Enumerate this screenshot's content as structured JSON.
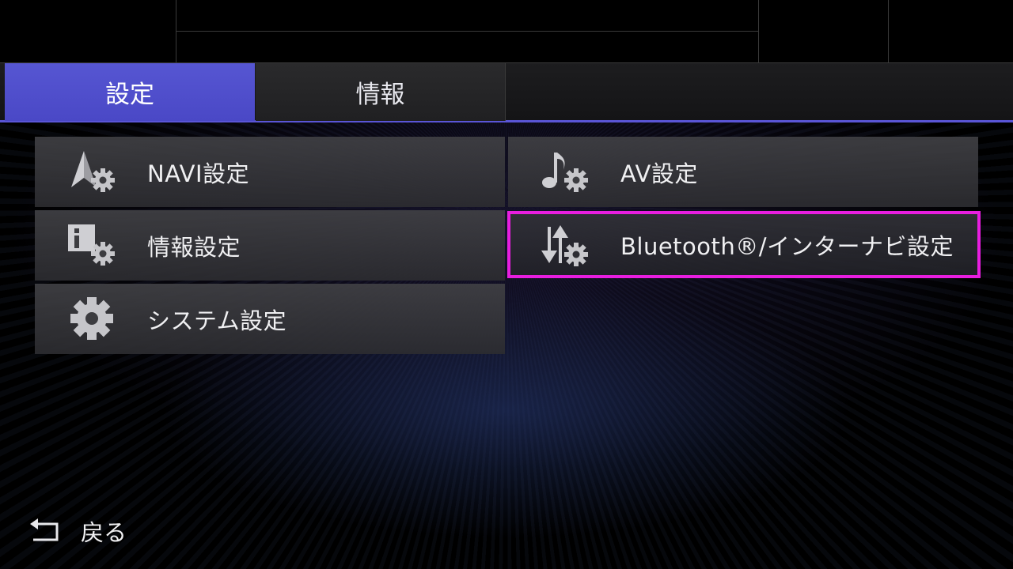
{
  "tabs": [
    {
      "label": "設定",
      "active": true
    },
    {
      "label": "情報",
      "active": false
    }
  ],
  "menu": {
    "items": [
      {
        "label": "NAVI設定",
        "icon": "navi-settings-icon"
      },
      {
        "label": "AV設定",
        "icon": "music-settings-icon"
      },
      {
        "label": "情報設定",
        "icon": "info-settings-icon"
      },
      {
        "label": "Bluetooth®/インターナビ設定",
        "icon": "bluetooth-internavi-settings-icon",
        "selected": true
      },
      {
        "label": "システム設定",
        "icon": "gear-icon"
      }
    ]
  },
  "footer": {
    "back_label": "戻る",
    "back_icon": "back-arrow-icon"
  },
  "colors": {
    "accent": "#4a48c6",
    "selection": "#e81ee0",
    "tile": "#3c3c40"
  }
}
